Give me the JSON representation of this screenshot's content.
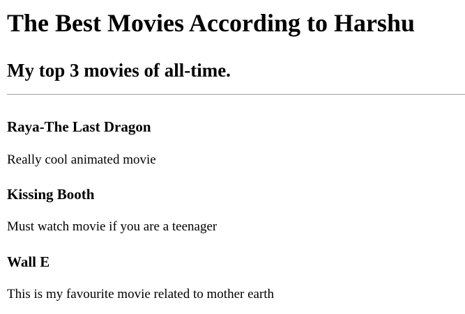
{
  "header": {
    "title": "The Best Movies According to Harshu",
    "subtitle": "My top 3 movies of all-time."
  },
  "movies": [
    {
      "title": "Raya-The Last Dragon",
      "description": "Really cool animated movie"
    },
    {
      "title": "Kissing Booth",
      "description": "Must watch movie if you are a teenager"
    },
    {
      "title": "Wall E",
      "description": "This is my favourite movie related to mother earth"
    }
  ]
}
